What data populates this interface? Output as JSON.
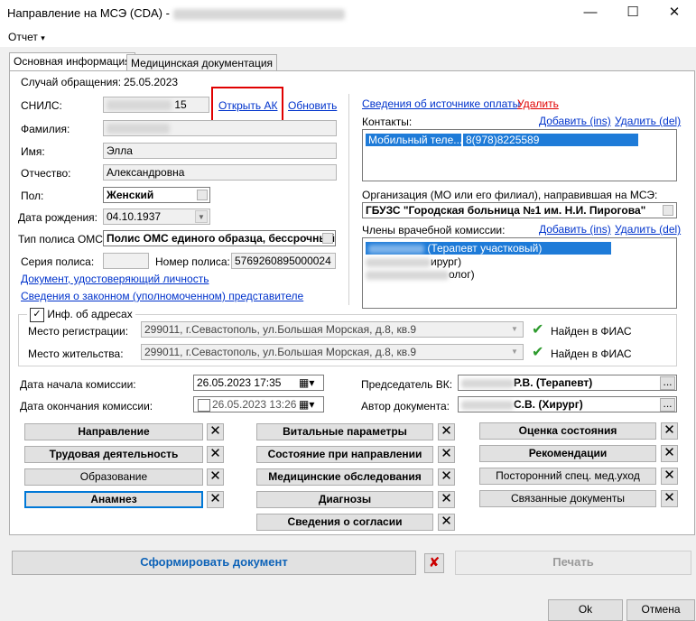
{
  "window": {
    "title": "Направление на МСЭ (CDA)",
    "title_sep": "-",
    "minimize": "—",
    "maximize": "☐",
    "close": "✕"
  },
  "menu": {
    "report": "Отчет",
    "report_arrow": "▾"
  },
  "tabs": [
    {
      "label": "Основная информация",
      "active": true
    },
    {
      "label": "Медицинская документация",
      "active": false
    }
  ],
  "left": {
    "case_label": "Случай обращения:",
    "case_value": "25.05.2023",
    "snils_label": "СНИЛС:",
    "snils_value": "15",
    "open_ak": "Открыть АК",
    "refresh": "Обновить",
    "lastname_label": "Фамилия:",
    "firstname_label": "Имя:",
    "firstname_value": "Элла",
    "middlename_label": "Отчество:",
    "middlename_value": "Александровна",
    "gender_label": "Пол:",
    "gender_value": "Женский",
    "birth_label": "Дата рождения:",
    "birth_value": "04.10.1937",
    "policy_type_label": "Тип полиса ОМС:",
    "policy_type_value": "Полис ОМС единого образца, бессрочный",
    "policy_series_label": "Серия полиса:",
    "policy_number_label": "Номер полиса:",
    "policy_number_value": "5769260895000024",
    "id_doc_link": "Документ, удостоверяющий личность",
    "rep_link": "Сведения о законном (уполномоченном) представителе"
  },
  "right": {
    "payment_link": "Сведения об источнике оплаты",
    "payment_delete": "Удалить",
    "contacts_label": "Контакты:",
    "contacts_add": "Добавить (ins)",
    "contacts_del": "Удалить (del)",
    "contact_type": "Мобильный теле...",
    "contact_value": "8(978)8225589",
    "org_label": "Организация (МО или его филиал), направившая на МСЭ:",
    "org_value": "ГБУЗС \"Городская больница №1 им. Н.И. Пирогова\"",
    "commission_label": "Члены врачебной комиссии:",
    "commission_add": "Добавить (ins)",
    "commission_del": "Удалить (del)",
    "members": [
      "(Терапевт участковый)",
      "ирург)",
      "олог)"
    ]
  },
  "address": {
    "group_label": "Инф. об адресах",
    "reg_label": "Место регистрации:",
    "reg_value": "299011, г.Севастополь, ул.Большая Морская, д.8, кв.9",
    "live_label": "Место жительства:",
    "live_value": "299011, г.Севастополь, ул.Большая Морская, д.8, кв.9",
    "fias_status": "Найден в ФИАС"
  },
  "commission": {
    "start_label": "Дата начала комиссии:",
    "start_value": "26.05.2023 17:35",
    "end_label": "Дата окончания комиссии:",
    "end_value": "26.05.2023 13:26",
    "chair_label": "Председатель ВК:",
    "chair_value": "Р.В. (Терапевт)",
    "author_label": "Автор документа:",
    "author_value": "С.В. (Хирург)",
    "ellipsis": "..."
  },
  "sections": {
    "col1": [
      {
        "label": "Направление",
        "bold": true
      },
      {
        "label": "Трудовая деятельность",
        "bold": true
      },
      {
        "label": "Образование",
        "bold": false
      },
      {
        "label": "Анамнез",
        "bold": true
      }
    ],
    "col2": [
      {
        "label": "Витальные параметры",
        "bold": true
      },
      {
        "label": "Состояние при направлении",
        "bold": true
      },
      {
        "label": "Медицинские обследования",
        "bold": true
      },
      {
        "label": "Диагнозы",
        "bold": true
      },
      {
        "label": "Сведения о согласии",
        "bold": true
      }
    ],
    "col3": [
      {
        "label": "Оценка состояния",
        "bold": true
      },
      {
        "label": "Рекомендации",
        "bold": true
      },
      {
        "label": "Посторонний спец. мед.уход",
        "bold": false
      },
      {
        "label": "Связанные документы",
        "bold": false
      }
    ],
    "remove_glyph": "✕"
  },
  "actions": {
    "generate": "Сформировать документ",
    "print": "Печать",
    "ok": "Ok",
    "cancel": "Отмена"
  }
}
